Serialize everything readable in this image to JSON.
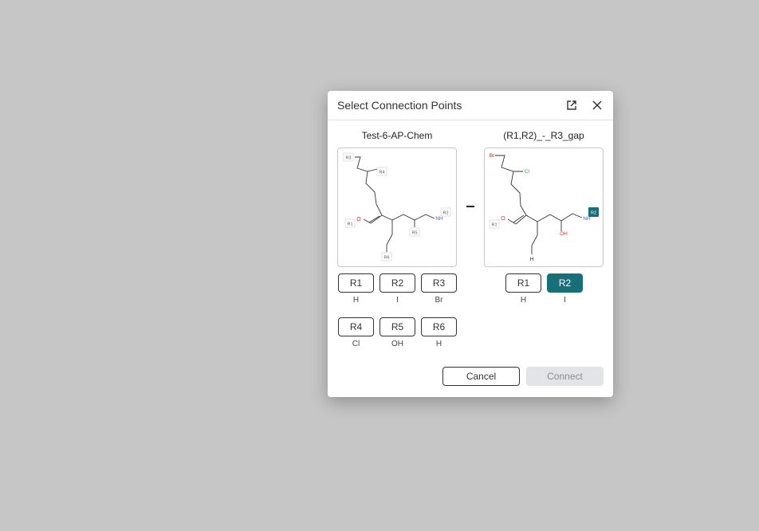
{
  "dialog": {
    "title": "Select Connection Points",
    "cancel_label": "Cancel",
    "connect_label": "Connect"
  },
  "left": {
    "name": "Test-6-AP-Chem",
    "atoms": {
      "o": "O",
      "nh": "NH"
    },
    "structure_labels": [
      "R1",
      "R2",
      "R3",
      "R4",
      "R5",
      "R6"
    ],
    "rgroups": [
      {
        "label": "R1",
        "value": "H"
      },
      {
        "label": "R2",
        "value": "I"
      },
      {
        "label": "R3",
        "value": "Br"
      },
      {
        "label": "R4",
        "value": "Cl"
      },
      {
        "label": "R5",
        "value": "OH"
      },
      {
        "label": "R6",
        "value": "H"
      }
    ]
  },
  "right": {
    "name": "(R1,R2)_-_R3_gap",
    "atoms": {
      "br": "Br",
      "cl": "Cl",
      "o": "O",
      "nh": "NH",
      "oh": "OH",
      "h": "H"
    },
    "structure_labels": [
      "R1",
      "R2"
    ],
    "rgroups": [
      {
        "label": "R1",
        "value": "H",
        "selected": false
      },
      {
        "label": "R2",
        "value": "I",
        "selected": true
      }
    ]
  },
  "colors": {
    "selected": "#167079",
    "oxygen": "#e03030",
    "nitrogen": "#2f5fd0",
    "chlorine": "#21b021",
    "bromine": "#a0392a"
  },
  "icons": {
    "open": "open-in-new-icon",
    "close": "close-icon"
  }
}
